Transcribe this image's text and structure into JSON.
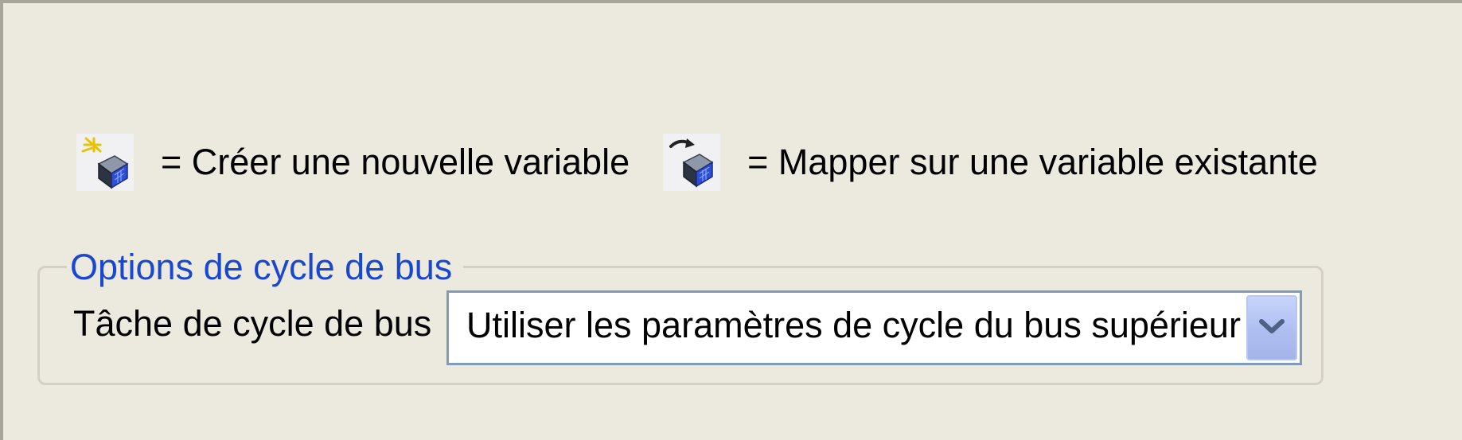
{
  "legend": {
    "new_variable": {
      "icon": "new-variable-icon",
      "text": "= Créer une nouvelle variable"
    },
    "map_variable": {
      "icon": "map-variable-icon",
      "text": "= Mapper sur une variable existante"
    }
  },
  "bus_cycle_options": {
    "title": "Options de cycle de bus",
    "task_label": "Tâche de cycle de bus",
    "task_value": "Utiliser les paramètres de cycle du bus supérieur",
    "dropdown_icon": "chevron-down-icon"
  },
  "colors": {
    "panel_background": "#ece9de",
    "group_title": "#1a47cf",
    "combo_border": "#7f9db9",
    "dropdown_button": "#aebef0"
  }
}
